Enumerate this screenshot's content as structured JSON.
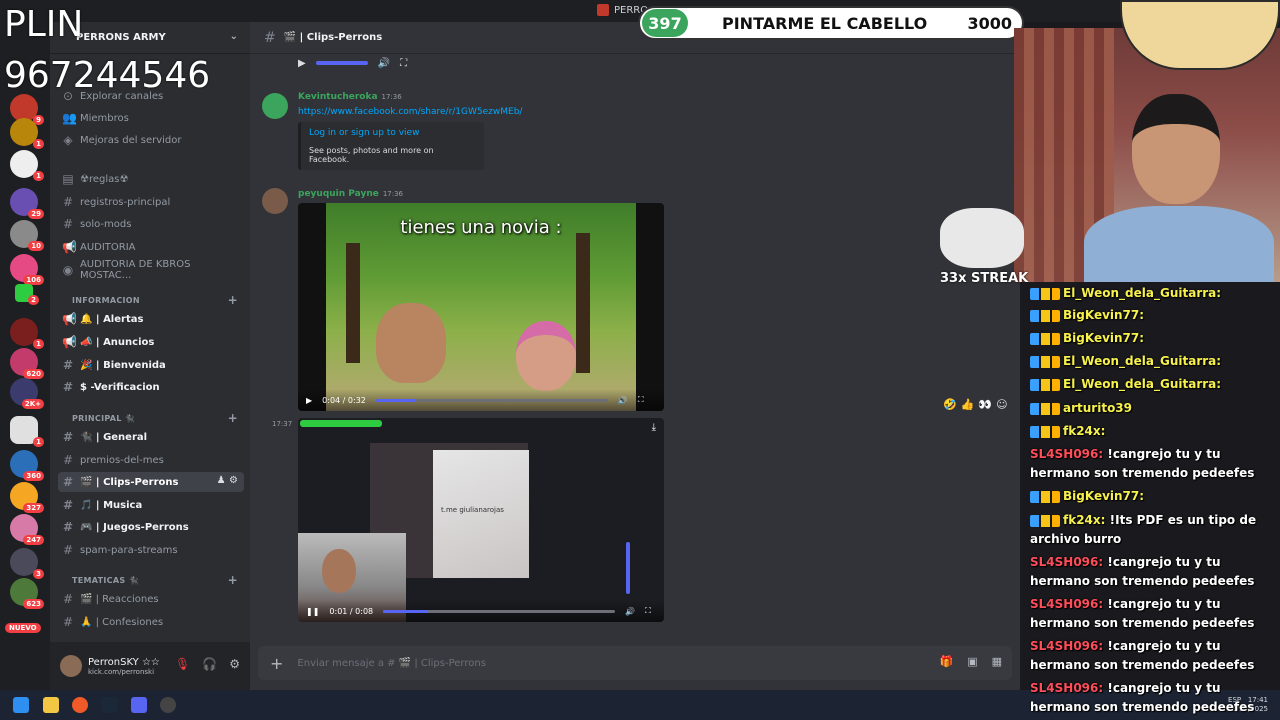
{
  "window": {
    "title": "PERRO..."
  },
  "overlay": {
    "plin": "PLIN",
    "phone": "967244546",
    "goal": {
      "count": "397",
      "label": "PINTARME EL CABELLO",
      "target": "3000"
    },
    "streak": "33x STREAK"
  },
  "server": {
    "name": "PERRONS ARMY",
    "nuevo": "NUEVO"
  },
  "rail": {
    "badges": [
      "9",
      "1",
      "1",
      "29",
      "10",
      "106",
      "2",
      "1",
      "620",
      "2K+",
      "1",
      "360",
      "327",
      "247",
      "3",
      "623"
    ]
  },
  "sidebar": {
    "top_items": [
      {
        "label": "Explorar canales",
        "icon": "compass-icon"
      },
      {
        "label": "Miembros",
        "icon": "members-icon"
      },
      {
        "label": "Mejoras del servidor",
        "icon": "boost-icon"
      }
    ],
    "channels_a": [
      {
        "label": "☢reglas☢",
        "icon": "rules-icon"
      },
      {
        "label": "registros-principal",
        "icon": "#"
      },
      {
        "label": "solo-mods",
        "icon": "#"
      },
      {
        "label": "AUDITORIA",
        "icon": "megaphone-icon"
      },
      {
        "label": "AUDITORIA DE KBROS MOSTAC...",
        "icon": "broadcast-icon"
      }
    ],
    "cat_info": "INFORMACION",
    "info_channels": [
      {
        "label": "🔔 | Alertas",
        "icon": "megaphone-icon"
      },
      {
        "label": "📣 | Anuncios",
        "icon": "megaphone-icon"
      },
      {
        "label": "🎉 | Bienvenida",
        "icon": "#"
      },
      {
        "label": "$ -Verificacion",
        "icon": "#"
      }
    ],
    "cat_principal": "PRINCIPAL 🐈‍⬛",
    "principal_channels": [
      {
        "label": "🐈‍⬛ | General",
        "icon": "#",
        "bold": true
      },
      {
        "label": "premios-del-mes",
        "icon": "#",
        "bold": false
      },
      {
        "label": "🎬 | Clips-Perrons",
        "icon": "#",
        "active": true
      },
      {
        "label": "🎵 | Musica",
        "icon": "#",
        "bold": true
      },
      {
        "label": "🎮 | Juegos-Perrons",
        "icon": "#",
        "bold": true
      },
      {
        "label": "spam-para-streams",
        "icon": "#",
        "bold": false
      }
    ],
    "cat_tematicas": "TEMATICAS 🐈‍⬛",
    "tematicas_channels": [
      {
        "label": "🎬 | Reacciones",
        "icon": "#"
      },
      {
        "label": "🙏 | Confesiones",
        "icon": "#"
      }
    ],
    "user": {
      "name": "PerronSKY ☆☆",
      "sub": "kick.com/perronski"
    }
  },
  "chat": {
    "channel": "🎬 | Clips-Perrons",
    "messages": [
      {
        "author": "Kevintucheroka",
        "time": "17:36",
        "link": "https://www.facebook.com/share/r/1GW5ezwMEb/",
        "embed_title": "Log in or sign up to view",
        "embed_desc": "See posts, photos and more on Facebook."
      },
      {
        "author": "peyuquin Payne",
        "time": "17:36",
        "video_caption": "tienes una novia :",
        "video_time": "0:04 / 0:32"
      }
    ],
    "hover_time": "17:37",
    "video2": {
      "overlay_text": "t.me giulianarojas",
      "time": "0:01 / 0:08"
    },
    "reactions": [
      "🤣",
      "👍",
      "👀",
      "☺"
    ],
    "composer_placeholder": "Enviar mensaje a # 🎬 | Clips-Perrons"
  },
  "stream_chat": [
    {
      "user": "El_Weon_dela_Guitarra:",
      "msg": "",
      "color": "yellow"
    },
    {
      "user": "BigKevin77:",
      "msg": "",
      "color": "yellow"
    },
    {
      "user": "BigKevin77:",
      "msg": "",
      "color": "yellow"
    },
    {
      "user": "El_Weon_dela_Guitarra:",
      "msg": "",
      "color": "yellow"
    },
    {
      "user": "El_Weon_dela_Guitarra:",
      "msg": "",
      "color": "yellow"
    },
    {
      "user": "arturito39",
      "msg": "",
      "color": "yellow"
    },
    {
      "user": "fk24x:",
      "msg": "",
      "color": "yellow"
    },
    {
      "user": "SL4SH096:",
      "msg": "!cangrejo tu y tu hermano son tremendo pedeefes",
      "color": "red"
    },
    {
      "user": "BigKevin77:",
      "msg": "",
      "color": "yellow"
    },
    {
      "user": "fk24x:",
      "msg": "!Its PDF es un tipo de archivo burro",
      "color": "yellow"
    },
    {
      "user": "SL4SH096:",
      "msg": "!cangrejo tu y tu hermano son tremendo pedeefes",
      "color": "red"
    },
    {
      "user": "SL4SH096:",
      "msg": "!cangrejo tu y tu hermano son tremendo pedeefes",
      "color": "red"
    },
    {
      "user": "SL4SH096:",
      "msg": "!cangrejo tu y tu hermano son tremendo pedeefes",
      "color": "red"
    },
    {
      "user": "SL4SH096:",
      "msg": "!cangrejo tu y tu hermano son tremendo pedeefes",
      "color": "red"
    }
  ],
  "tray": {
    "lang": "ESP",
    "time": "17:41",
    "date": "29/10/2025"
  },
  "colors": {
    "accent": "#5865f2",
    "link": "#00a8fc",
    "green": "#3ba55d",
    "danger": "#f23f43"
  }
}
